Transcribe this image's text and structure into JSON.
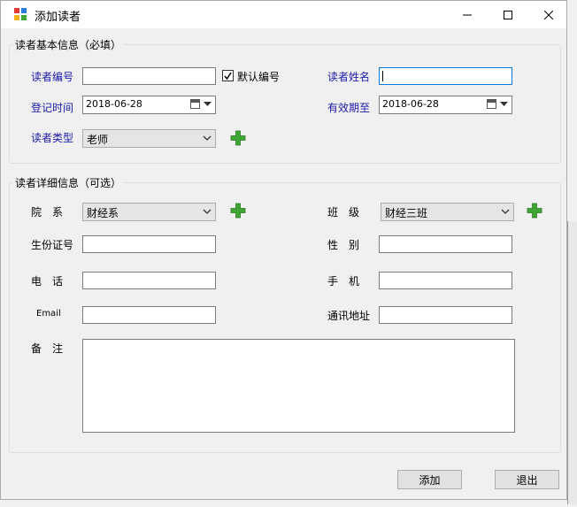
{
  "window": {
    "title": "添加读者"
  },
  "basic": {
    "legend": "读者基本信息（必填）",
    "reader_no_label": "读者编号",
    "reader_no_value": "",
    "default_no_label": "默认编号",
    "default_no_checked": true,
    "reader_name_label": "读者姓名",
    "reader_name_value": "",
    "reg_time_label": "登记时间",
    "reg_time_value": "2018-06-28",
    "expiry_label": "有效期至",
    "expiry_value": "2018-06-28",
    "type_label": "读者类型",
    "type_value": "老师"
  },
  "detail": {
    "legend": "读者详细信息（可选）",
    "dept_label": "院　系",
    "dept_value": "财经系",
    "class_label": "班　级",
    "class_value": "财经三班",
    "id_label": "生份证号",
    "id_value": "",
    "gender_label": "性　别",
    "gender_value": "",
    "phone_label": "电　话",
    "phone_value": "",
    "mobile_label": "手　机",
    "mobile_value": "",
    "email_label": "Email",
    "email_value": "",
    "address_label": "通讯地址",
    "address_value": "",
    "remark_label": "备　注",
    "remark_value": ""
  },
  "buttons": {
    "add": "添加",
    "exit": "退出"
  },
  "icons": {
    "add": "plus-icon",
    "calendar": "calendar-icon",
    "dropdown": "chevron-down-icon"
  },
  "colors": {
    "label_blue": "#1a1aa8",
    "plus_green": "#3fa535",
    "focus_border": "#0078d7"
  }
}
